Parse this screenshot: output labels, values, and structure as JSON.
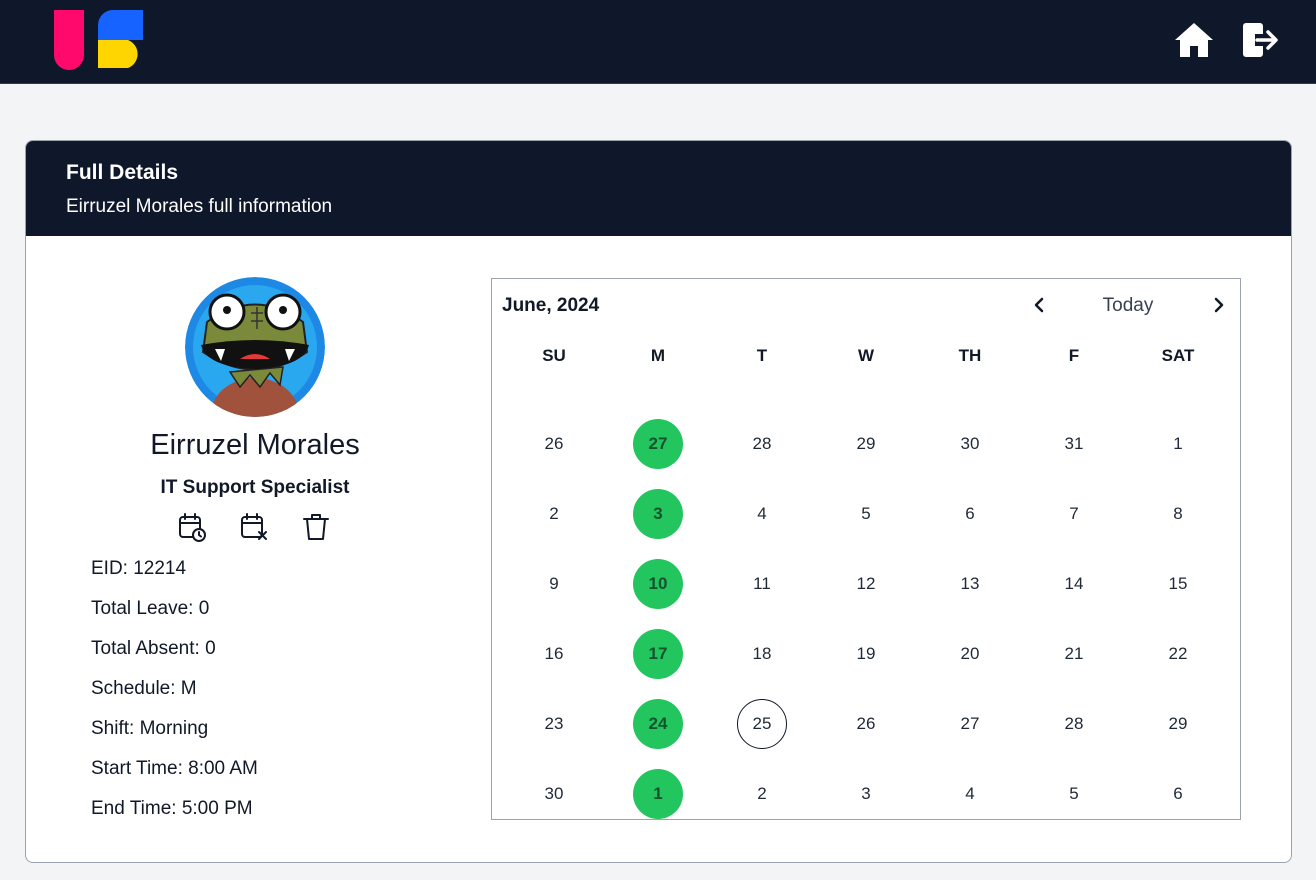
{
  "colors": {
    "navbar": "#0f172a",
    "accent_green": "#22c55e",
    "background": "#f2f4f6"
  },
  "icons": {
    "logo": "us-logo-icon",
    "home": "home-icon",
    "logout": "logout-icon",
    "schedule": "calendar-clock-icon",
    "absent": "calendar-x-icon",
    "delete": "trash-icon"
  },
  "card": {
    "title": "Full Details",
    "subtitle": "Eirruzel Morales full information"
  },
  "employee": {
    "name": "Eirruzel Morales",
    "role": "IT Support Specialist",
    "info": [
      "EID: 12214",
      "Total Leave: 0",
      "Total Absent: 0",
      "Schedule: M",
      "Shift: Morning",
      "Start Time: 8:00 AM",
      "End Time: 5:00 PM"
    ]
  },
  "calendar": {
    "month_label": "June, 2024",
    "today_label": "Today",
    "weekdays": [
      "SU",
      "M",
      "T",
      "W",
      "TH",
      "F",
      "SAT"
    ],
    "weeks": [
      [
        "26",
        "27",
        "28",
        "29",
        "30",
        "31",
        "1"
      ],
      [
        "2",
        "3",
        "4",
        "5",
        "6",
        "7",
        "8"
      ],
      [
        "9",
        "10",
        "11",
        "12",
        "13",
        "14",
        "15"
      ],
      [
        "16",
        "17",
        "18",
        "19",
        "20",
        "21",
        "22"
      ],
      [
        "23",
        "24",
        "25",
        "26",
        "27",
        "28",
        "29"
      ],
      [
        "30",
        "1",
        "2",
        "3",
        "4",
        "5",
        "6"
      ]
    ],
    "marked_weekday": "M",
    "today_day": "25"
  }
}
